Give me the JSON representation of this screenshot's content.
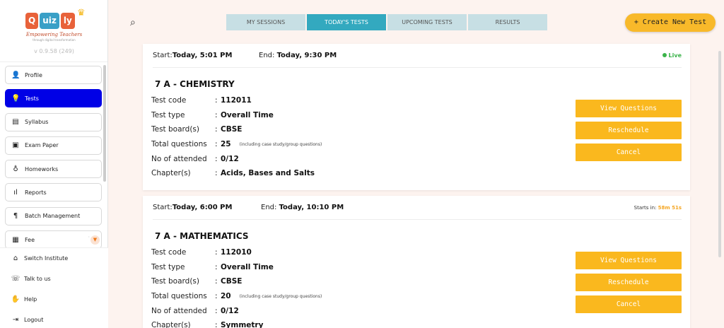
{
  "app": {
    "logo": [
      "Q",
      "uiz",
      "ly"
    ],
    "tagline": "Empowering Teachers",
    "tagline2": "through digital transformation",
    "version": "v 0.9.58 (249)"
  },
  "sidebar": {
    "items": [
      {
        "label": "Profile",
        "icon": "person-icon",
        "glyph": "👤"
      },
      {
        "label": "Tests",
        "icon": "lightbulb-icon",
        "glyph": "💡"
      },
      {
        "label": "Syllabus",
        "icon": "book-icon",
        "glyph": "▤"
      },
      {
        "label": "Exam Paper",
        "icon": "save-icon",
        "glyph": "▣"
      },
      {
        "label": "Homeworks",
        "icon": "bag-icon",
        "glyph": "♁"
      },
      {
        "label": "Reports",
        "icon": "bar-chart-icon",
        "glyph": "ıl"
      },
      {
        "label": "Batch Management",
        "icon": "paragraph-icon",
        "glyph": "¶"
      },
      {
        "label": "Fee",
        "icon": "receipt-icon",
        "glyph": "▦"
      }
    ],
    "bottom": [
      {
        "label": "Switch Institute",
        "icon": "institute-icon",
        "glyph": "⌂"
      },
      {
        "label": "Talk to us",
        "icon": "whatsapp-icon",
        "glyph": "☏"
      },
      {
        "label": "Help",
        "icon": "handshake-icon",
        "glyph": "✋"
      },
      {
        "label": "Logout",
        "icon": "logout-icon",
        "glyph": "⇥"
      }
    ]
  },
  "tabs": [
    "MY SESSIONS",
    "TODAY'S TESTS",
    "UPCOMING TESTS",
    "RESULTS"
  ],
  "create_button": "+ Create New Test",
  "labels": {
    "start": "Start: ",
    "end": "End: ",
    "test_code": "Test code",
    "test_type": "Test type",
    "test_board": "Test board(s)",
    "total_questions": "Total questions",
    "attended": "No of attended",
    "chapters": "Chapter(s)",
    "colon": ":",
    "note": "(including case study/group questions)",
    "view_questions": "View Questions",
    "reschedule": "Reschedule",
    "cancel": "Cancel"
  },
  "tests": [
    {
      "start": "Today, 5:01 PM",
      "end": "Today, 9:30 PM",
      "status": "Live",
      "subject": "7 A - CHEMISTRY",
      "code": "112011",
      "type": "Overall Time",
      "board": "CBSE",
      "total": "25",
      "attended": "0/12",
      "chapters": "Acids, Bases and Salts"
    },
    {
      "start": "Today, 6:00 PM",
      "end": "Today, 10:10 PM",
      "status_prefix": "Starts in: ",
      "status_time": "58m 51s",
      "subject": "7 A - MATHEMATICS",
      "code": "112010",
      "type": "Overall Time",
      "board": "CBSE",
      "total": "20",
      "attended": "0/12",
      "chapters": "Symmetry"
    }
  ]
}
